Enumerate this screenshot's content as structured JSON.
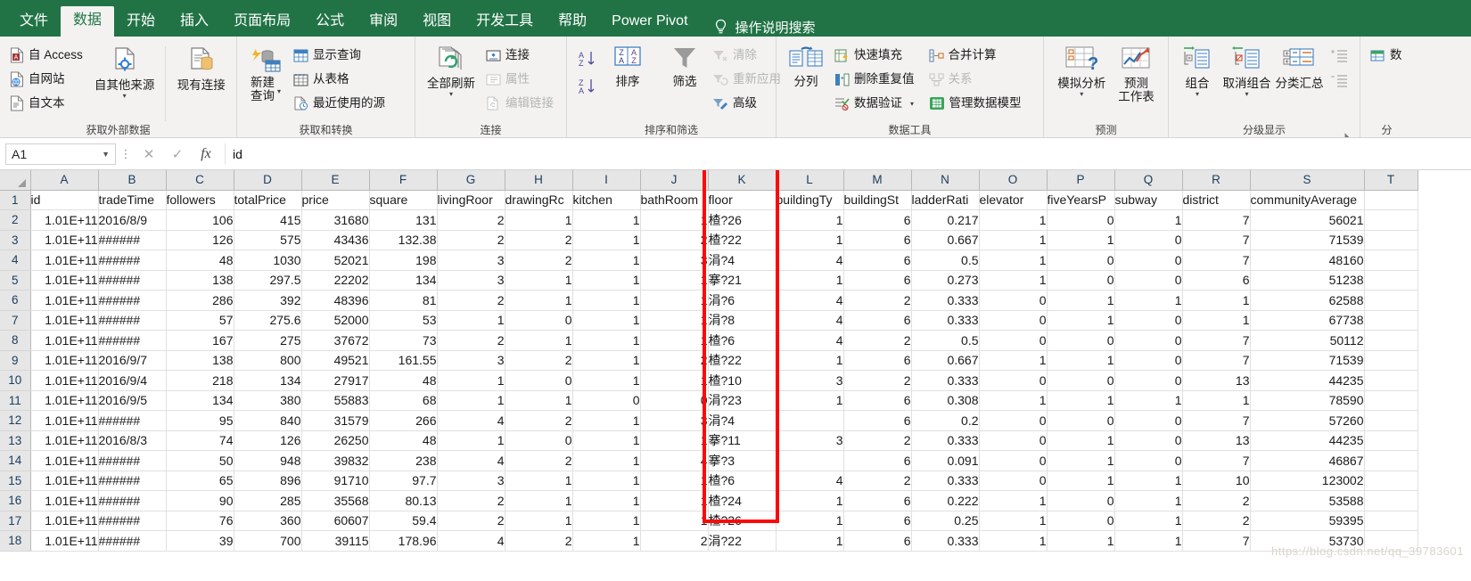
{
  "tabs": [
    {
      "label": "文件",
      "active": false
    },
    {
      "label": "数据",
      "active": true
    },
    {
      "label": "开始",
      "active": false
    },
    {
      "label": "插入",
      "active": false
    },
    {
      "label": "页面布局",
      "active": false
    },
    {
      "label": "公式",
      "active": false
    },
    {
      "label": "审阅",
      "active": false
    },
    {
      "label": "视图",
      "active": false
    },
    {
      "label": "开发工具",
      "active": false
    },
    {
      "label": "帮助",
      "active": false
    },
    {
      "label": "Power Pivot",
      "active": false
    }
  ],
  "tellme": {
    "icon": "lightbulb-icon",
    "label": "操作说明搜索"
  },
  "ribbon": {
    "groups": [
      {
        "title": "获取外部数据",
        "small": [
          {
            "label": "自 Access",
            "icon": "access-file-icon",
            "dim": false
          },
          {
            "label": "自网站",
            "icon": "web-file-icon",
            "dim": false
          },
          {
            "label": "自文本",
            "icon": "text-file-icon",
            "dim": false
          }
        ],
        "big": [
          {
            "label": "自其他来源",
            "icon": "other-sources-icon",
            "caret": true
          },
          {
            "label": "现有连接",
            "icon": "existing-connections-icon",
            "caret": false
          }
        ]
      },
      {
        "title": "获取和转换",
        "big": [
          {
            "label": "新建\n查询",
            "icon": "new-query-icon",
            "caret": true
          }
        ],
        "small": [
          {
            "label": "显示查询",
            "icon": "show-queries-icon",
            "dim": false
          },
          {
            "label": "从表格",
            "icon": "from-table-icon",
            "dim": false
          },
          {
            "label": "最近使用的源",
            "icon": "recent-sources-icon",
            "dim": false
          }
        ]
      },
      {
        "title": "连接",
        "big": [
          {
            "label": "全部刷新",
            "icon": "refresh-all-icon",
            "caret": true
          }
        ],
        "small": [
          {
            "label": "连接",
            "icon": "connections-icon",
            "dim": false
          },
          {
            "label": "属性",
            "icon": "properties-icon",
            "dim": true
          },
          {
            "label": "编辑链接",
            "icon": "edit-links-icon",
            "dim": true
          }
        ]
      },
      {
        "title": "排序和筛选",
        "sortAZ": "sort-ascending-icon",
        "sortZA": "sort-descending-icon",
        "big": [
          {
            "label": "排序",
            "icon": "sort-dialog-icon",
            "caret": false
          },
          {
            "label": "筛选",
            "icon": "filter-funnel-icon",
            "caret": false
          }
        ],
        "small": [
          {
            "label": "清除",
            "icon": "clear-filter-icon",
            "dim": true
          },
          {
            "label": "重新应用",
            "icon": "reapply-icon",
            "dim": true
          },
          {
            "label": "高级",
            "icon": "advanced-filter-icon",
            "dim": false
          }
        ]
      },
      {
        "title": "数据工具",
        "big": [
          {
            "label": "分列",
            "icon": "text-to-columns-icon",
            "caret": false
          }
        ],
        "small": [
          {
            "label": "快速填充",
            "icon": "flash-fill-icon",
            "dim": false
          },
          {
            "label": "删除重复值",
            "icon": "remove-duplicates-icon",
            "dim": false
          },
          {
            "label": "数据验证",
            "icon": "data-validation-icon",
            "dim": false
          }
        ],
        "small2": [
          {
            "label": "合并计算",
            "icon": "consolidate-icon",
            "dim": false
          },
          {
            "label": "关系",
            "icon": "relationships-icon",
            "dim": true
          },
          {
            "label": "管理数据模型",
            "icon": "manage-data-model-icon",
            "dim": false
          }
        ]
      },
      {
        "title": "预测",
        "big": [
          {
            "label": "模拟分析",
            "icon": "what-if-analysis-icon",
            "caret": true
          },
          {
            "label": "预测\n工作表",
            "icon": "forecast-sheet-icon",
            "caret": false
          }
        ]
      },
      {
        "title": "分级显示",
        "big": [
          {
            "label": "组合",
            "icon": "group-icon",
            "caret": true
          },
          {
            "label": "取消组合",
            "icon": "ungroup-icon",
            "caret": true
          },
          {
            "label": "分类汇总",
            "icon": "subtotal-icon",
            "caret": false
          }
        ],
        "small": [
          {
            "label": "",
            "icon": "show-detail-icon",
            "dim": true
          },
          {
            "label": "",
            "icon": "hide-detail-icon",
            "dim": true
          }
        ],
        "launcher": "dialog-launcher-icon"
      },
      {
        "title": "分",
        "small": [
          {
            "label": "数",
            "icon": "partial-icon",
            "dim": false
          }
        ]
      }
    ]
  },
  "formula_bar": {
    "name_box": "A1",
    "cancel_icon": "cancel-icon",
    "confirm_icon": "confirm-icon",
    "fx_icon": "function-icon",
    "value": "id"
  },
  "sheet": {
    "columns": [
      "A",
      "B",
      "C",
      "D",
      "E",
      "F",
      "G",
      "H",
      "I",
      "J",
      "K",
      "L",
      "M",
      "N",
      "O",
      "P",
      "Q",
      "R",
      "S",
      "T"
    ],
    "header_row": [
      "id",
      "tradeTime",
      "followers",
      "totalPrice",
      "price",
      "square",
      "livingRoor",
      "drawingRc",
      "kitchen",
      "bathRoom",
      "floor",
      "buildingTy",
      "buildingSt",
      "ladderRati",
      "elevator",
      "fiveYearsP",
      "subway",
      "district",
      "communityAverage",
      ""
    ],
    "row_numbers": [
      1,
      2,
      3,
      4,
      5,
      6,
      7,
      8,
      9,
      10,
      11,
      12,
      13,
      14,
      15,
      16,
      17,
      18
    ],
    "highlight": {
      "column": "K",
      "color": "#fb0a0a"
    },
    "watermark": "https://blog.csdn.net/qq_39783601",
    "rows": [
      [
        "1.01E+11",
        "2016/8/9",
        "106",
        "415",
        "31680",
        "131",
        "2",
        "1",
        "1",
        "1",
        "楂?26",
        "1",
        "6",
        "0.217",
        "1",
        "0",
        "1",
        "7",
        "56021",
        ""
      ],
      [
        "1.01E+11",
        "######",
        "126",
        "575",
        "43436",
        "132.38",
        "2",
        "2",
        "1",
        "2",
        "楂?22",
        "1",
        "6",
        "0.667",
        "1",
        "1",
        "0",
        "7",
        "71539",
        ""
      ],
      [
        "1.01E+11",
        "######",
        "48",
        "1030",
        "52021",
        "198",
        "3",
        "2",
        "1",
        "3",
        "涓?4",
        "4",
        "6",
        "0.5",
        "1",
        "0",
        "0",
        "7",
        "48160",
        ""
      ],
      [
        "1.01E+11",
        "######",
        "138",
        "297.5",
        "22202",
        "134",
        "3",
        "1",
        "1",
        "1",
        "搴?21",
        "1",
        "6",
        "0.273",
        "1",
        "0",
        "0",
        "6",
        "51238",
        ""
      ],
      [
        "1.01E+11",
        "######",
        "286",
        "392",
        "48396",
        "81",
        "2",
        "1",
        "1",
        "1",
        "涓?6",
        "4",
        "2",
        "0.333",
        "0",
        "1",
        "1",
        "1",
        "62588",
        ""
      ],
      [
        "1.01E+11",
        "######",
        "57",
        "275.6",
        "52000",
        "53",
        "1",
        "0",
        "1",
        "1",
        "涓?8",
        "4",
        "6",
        "0.333",
        "0",
        "1",
        "0",
        "1",
        "67738",
        ""
      ],
      [
        "1.01E+11",
        "######",
        "167",
        "275",
        "37672",
        "73",
        "2",
        "1",
        "1",
        "1",
        "楂?6",
        "4",
        "2",
        "0.5",
        "0",
        "0",
        "0",
        "7",
        "50112",
        ""
      ],
      [
        "1.01E+11",
        "2016/9/7",
        "138",
        "800",
        "49521",
        "161.55",
        "3",
        "2",
        "1",
        "2",
        "楂?22",
        "1",
        "6",
        "0.667",
        "1",
        "1",
        "0",
        "7",
        "71539",
        ""
      ],
      [
        "1.01E+11",
        "2016/9/4",
        "218",
        "134",
        "27917",
        "48",
        "1",
        "0",
        "1",
        "1",
        "楂?10",
        "3",
        "2",
        "0.333",
        "0",
        "0",
        "0",
        "13",
        "44235",
        ""
      ],
      [
        "1.01E+11",
        "2016/9/5",
        "134",
        "380",
        "55883",
        "68",
        "1",
        "1",
        "0",
        "0",
        "涓?23",
        "1",
        "6",
        "0.308",
        "1",
        "1",
        "1",
        "1",
        "78590",
        ""
      ],
      [
        "1.01E+11",
        "######",
        "95",
        "840",
        "31579",
        "266",
        "4",
        "2",
        "1",
        "3",
        "涓?4",
        "",
        "6",
        "0.2",
        "0",
        "0",
        "0",
        "7",
        "57260",
        ""
      ],
      [
        "1.01E+11",
        "2016/8/3",
        "74",
        "126",
        "26250",
        "48",
        "1",
        "0",
        "1",
        "1",
        "搴?11",
        "3",
        "2",
        "0.333",
        "0",
        "1",
        "0",
        "13",
        "44235",
        ""
      ],
      [
        "1.01E+11",
        "######",
        "50",
        "948",
        "39832",
        "238",
        "4",
        "2",
        "1",
        "4",
        "搴?3",
        "",
        "6",
        "0.091",
        "0",
        "1",
        "0",
        "7",
        "46867",
        ""
      ],
      [
        "1.01E+11",
        "######",
        "65",
        "896",
        "91710",
        "97.7",
        "3",
        "1",
        "1",
        "1",
        "楂?6",
        "4",
        "2",
        "0.333",
        "0",
        "1",
        "1",
        "10",
        "123002",
        ""
      ],
      [
        "1.01E+11",
        "######",
        "90",
        "285",
        "35568",
        "80.13",
        "2",
        "1",
        "1",
        "1",
        "楂?24",
        "1",
        "6",
        "0.222",
        "1",
        "0",
        "1",
        "2",
        "53588",
        ""
      ],
      [
        "1.01E+11",
        "######",
        "76",
        "360",
        "60607",
        "59.4",
        "2",
        "1",
        "1",
        "1",
        "楂?26",
        "1",
        "6",
        "0.25",
        "1",
        "0",
        "1",
        "2",
        "59395",
        ""
      ],
      [
        "1.01E+11",
        "######",
        "39",
        "700",
        "39115",
        "178.96",
        "4",
        "2",
        "1",
        "2",
        "涓?22",
        "1",
        "6",
        "0.333",
        "1",
        "1",
        "1",
        "7",
        "53730",
        ""
      ]
    ]
  }
}
